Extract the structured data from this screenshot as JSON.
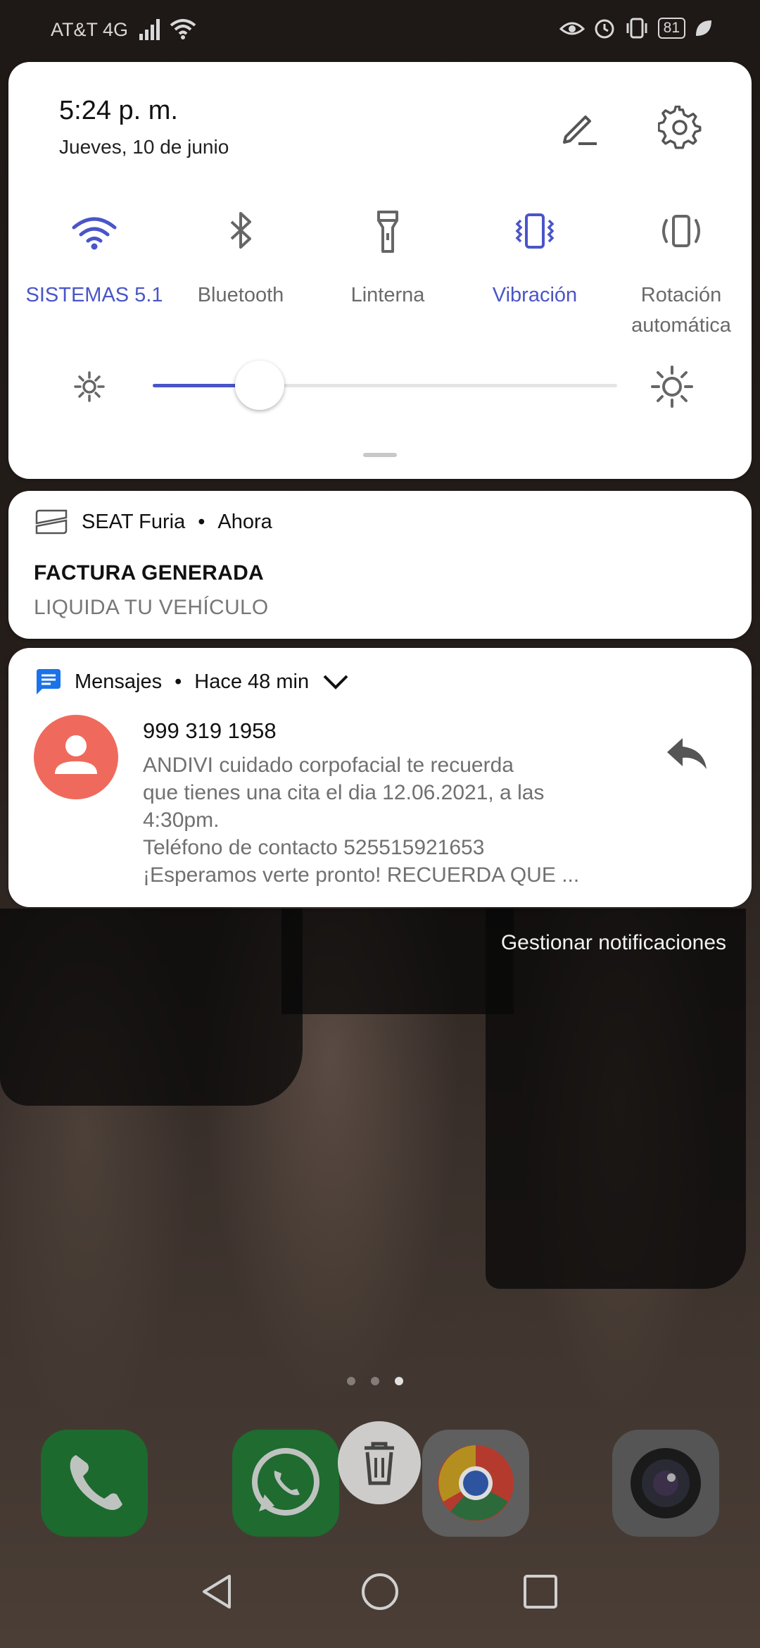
{
  "status_bar": {
    "carrier": "AT&T 4G",
    "battery": "81",
    "icons": [
      "signal-icon",
      "wifi-icon",
      "eye-comfort-icon",
      "alarm-icon",
      "vibrate-icon",
      "battery-icon",
      "leaf-icon"
    ]
  },
  "quick_settings": {
    "time": "5:24 p. m.",
    "date": "Jueves, 10 de junio",
    "tiles": [
      {
        "label": "SISTEMAS 5.1",
        "icon": "wifi-icon",
        "active": true
      },
      {
        "label": "Bluetooth",
        "icon": "bluetooth-icon",
        "active": false
      },
      {
        "label": "Linterna",
        "icon": "flashlight-icon",
        "active": false
      },
      {
        "label": "Vibración",
        "icon": "vibrate-icon",
        "active": true
      },
      {
        "label": "Rotación automática",
        "label_line1": "Rotación",
        "label_line2": "automática",
        "icon": "auto-rotate-icon",
        "active": false
      }
    ],
    "brightness_fraction": 0.23,
    "accent_color": "#4a55c8"
  },
  "notifications": [
    {
      "app": "SEAT Furia",
      "time": "Ahora",
      "title": "FACTURA GENERADA",
      "text": "LIQUIDA TU VEHÍCULO"
    },
    {
      "app": "Mensajes",
      "time": "Hace 48 min",
      "sender": "999 319 1958",
      "lines": [
        "ANDIVI cuidado corpofacial te recuerda",
        "que tienes una cita el dia 12.06.2021, a las",
        "4:30pm.",
        "Teléfono de contacto 525515921653",
        "¡Esperamos verte pronto! RECUERDA QUE ..."
      ],
      "avatar_color": "#ef6a5c"
    }
  ],
  "manage_label": "Gestionar notificaciones",
  "dock": {
    "apps": [
      "phone-app-icon",
      "whatsapp-app-icon",
      "chrome-app-icon",
      "camera-app-icon"
    ],
    "page_count": 3,
    "active_page": 3
  },
  "separator": "•"
}
